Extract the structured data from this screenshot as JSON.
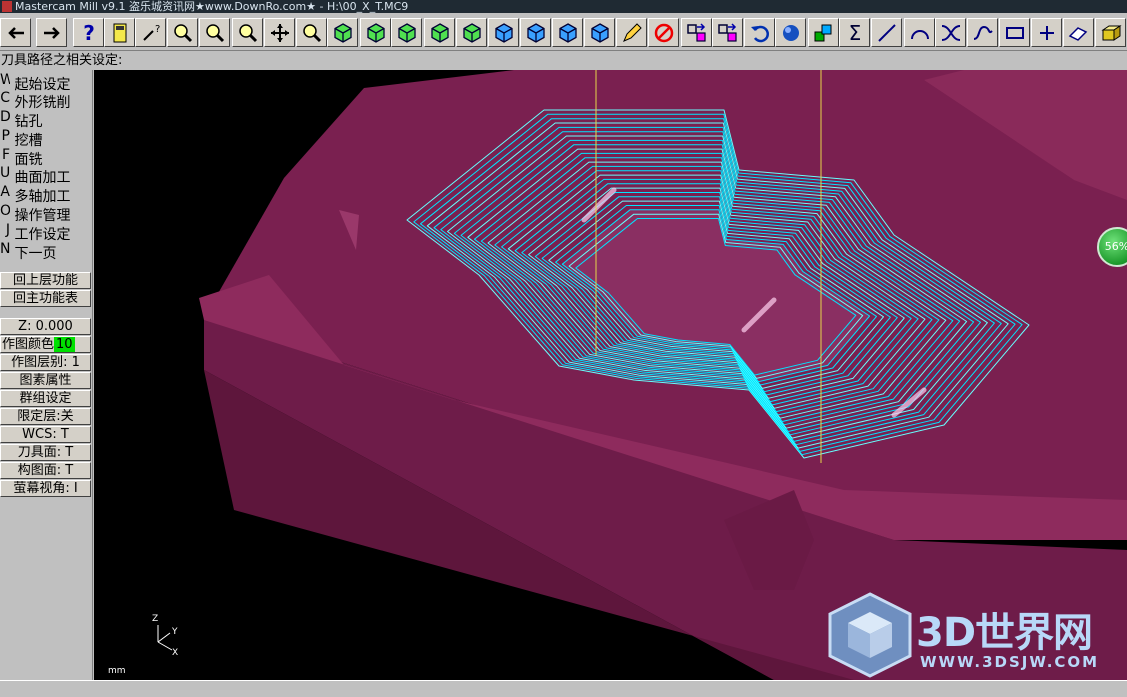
{
  "window": {
    "title": "Mastercam Mill v9.1 盗乐城资讯网★www.DownRo.com★ - H:\\00_X_T.MC9"
  },
  "toolbar": {
    "buttons": [
      {
        "name": "back-arrow-icon"
      },
      {
        "name": "forward-arrow-icon"
      },
      {
        "name": "help-icon"
      },
      {
        "name": "calculator-icon"
      },
      {
        "name": "analyze-icon"
      },
      {
        "name": "zoom-in-icon"
      },
      {
        "name": "zoom-out-icon"
      },
      {
        "name": "zoom-prev-icon"
      },
      {
        "name": "pan-icon"
      },
      {
        "name": "zoom-window-icon"
      },
      {
        "name": "rotate-view-icon"
      },
      {
        "name": "iso-view-icon"
      },
      {
        "name": "top-view-icon"
      },
      {
        "name": "front-view-icon"
      },
      {
        "name": "side-view-icon"
      },
      {
        "name": "cube-view-1-icon"
      },
      {
        "name": "cube-view-2-icon"
      },
      {
        "name": "cube-view-3-icon"
      },
      {
        "name": "cube-view-4-icon"
      },
      {
        "name": "pencil-icon"
      },
      {
        "name": "no-delete-icon"
      },
      {
        "name": "transform-1-icon"
      },
      {
        "name": "transform-2-icon"
      },
      {
        "name": "undo-icon"
      },
      {
        "name": "shade-sphere-icon"
      },
      {
        "name": "level-icon"
      },
      {
        "name": "sum-icon"
      },
      {
        "name": "line-icon"
      },
      {
        "name": "arc-icon"
      },
      {
        "name": "fillet-icon"
      },
      {
        "name": "spline-icon"
      },
      {
        "name": "rectangle-icon"
      },
      {
        "name": "point-icon"
      },
      {
        "name": "eraser-icon"
      },
      {
        "name": "solid-box-icon"
      }
    ]
  },
  "prompt": "刀具路径之相关设定:",
  "menu": {
    "items": [
      {
        "key": "W",
        "label": "起始设定"
      },
      {
        "key": "C",
        "label": "外形铣削"
      },
      {
        "key": "D",
        "label": "钻孔"
      },
      {
        "key": "P",
        "label": "挖槽"
      },
      {
        "key": "F",
        "label": "面铣"
      },
      {
        "key": "U",
        "label": "曲面加工"
      },
      {
        "key": "A",
        "label": "多轴加工"
      },
      {
        "key": "O",
        "label": "操作管理"
      },
      {
        "key": "J",
        "label": "工作设定"
      },
      {
        "key": "N",
        "label": "下一页"
      }
    ],
    "back_upper": "回上层功能",
    "back_main": "回主功能表"
  },
  "status": {
    "z": "Z:  0.000",
    "color_label": "作图颜色",
    "color_value": "10",
    "level": "作图层别: 1",
    "attributes": "图素属性",
    "group": "群组设定",
    "mask": "限定层:关",
    "wcs": "WCS:  T",
    "tplane": "刀具面: T",
    "cplane": "构图面: T",
    "gview": "萤幕视角: I"
  },
  "viewport": {
    "units": "mm",
    "axis": {
      "z": "Z",
      "y": "Y",
      "x": "X"
    },
    "progress_badge": "56%",
    "progress_value": 56,
    "colors": {
      "part": "#7a2050",
      "part_side": "#6e1c49",
      "toolpath": "#00e5ff",
      "tool_axis": "#e6d64a",
      "background": "#000000"
    }
  },
  "watermark": {
    "text": "3D世界网",
    "url": "WWW.3DSJW.COM"
  }
}
